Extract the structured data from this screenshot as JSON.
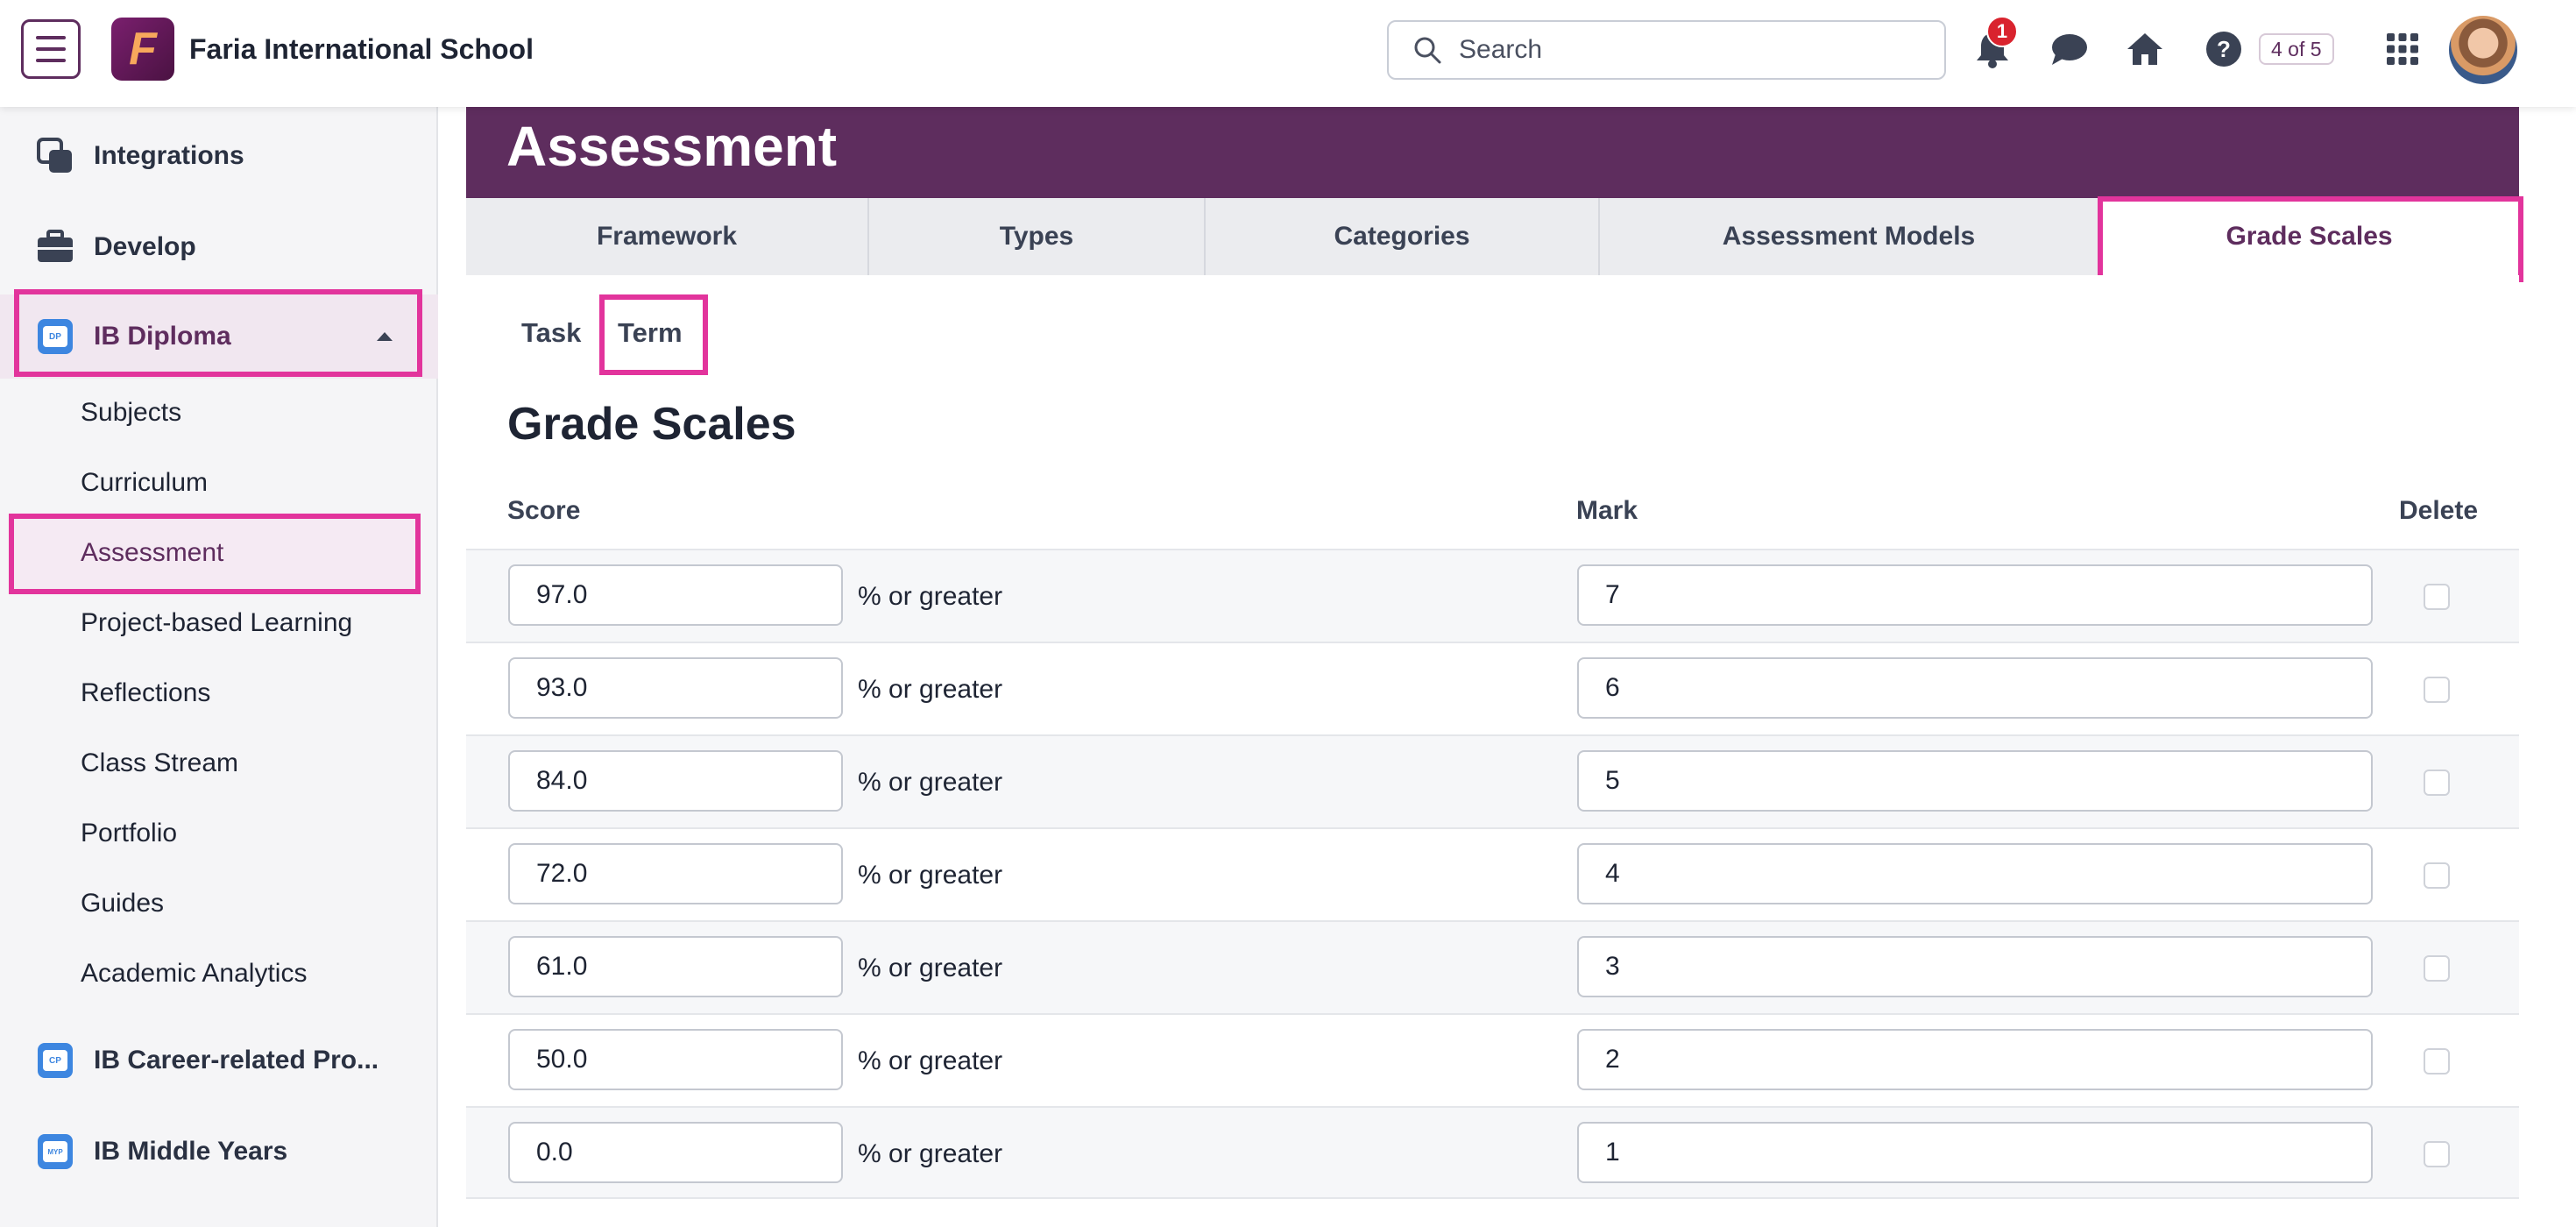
{
  "topbar": {
    "school_name": "Faria International School",
    "logo_letter": "F",
    "search_placeholder": "Search",
    "notification_count": "1",
    "pager_text": "4 of 5"
  },
  "sidebar": {
    "items": [
      {
        "label": "Integrations",
        "icon": "integrations-icon"
      },
      {
        "label": "Develop",
        "icon": "briefcase-icon"
      },
      {
        "label": "IB Diploma",
        "icon": "ib-diploma-icon",
        "badge_text": "DP"
      }
    ],
    "sub_items": [
      "Subjects",
      "Curriculum",
      "Assessment",
      "Project-based Learning",
      "Reflections",
      "Class Stream",
      "Portfolio",
      "Guides",
      "Academic Analytics"
    ],
    "programmes": [
      {
        "label": "IB Career-related Pro...",
        "badge_text": "CP"
      },
      {
        "label": "IB Middle Years",
        "badge_text": "MYP"
      }
    ],
    "active_sub_item": "Assessment"
  },
  "main": {
    "header_title": "Assessment",
    "tabs": [
      "Framework",
      "Types",
      "Categories",
      "Assessment Models",
      "Grade Scales"
    ],
    "active_tab": "Grade Scales",
    "subtabs": [
      "Task",
      "Term"
    ],
    "active_subtab": "Term",
    "section_title": "Grade Scales",
    "columns": {
      "score": "Score",
      "mark": "Mark",
      "delete": "Delete"
    },
    "score_suffix": "% or greater",
    "rows": [
      {
        "score": "97.0",
        "mark": "7"
      },
      {
        "score": "93.0",
        "mark": "6"
      },
      {
        "score": "84.0",
        "mark": "5"
      },
      {
        "score": "72.0",
        "mark": "4"
      },
      {
        "score": "61.0",
        "mark": "3"
      },
      {
        "score": "50.0",
        "mark": "2"
      },
      {
        "score": "0.0",
        "mark": "1"
      }
    ]
  },
  "colors": {
    "brand_purple": "#5e2d5e",
    "highlight_pink": "#e2349c",
    "notification_red": "#d9232e",
    "programme_blue": "#3d86e0"
  }
}
